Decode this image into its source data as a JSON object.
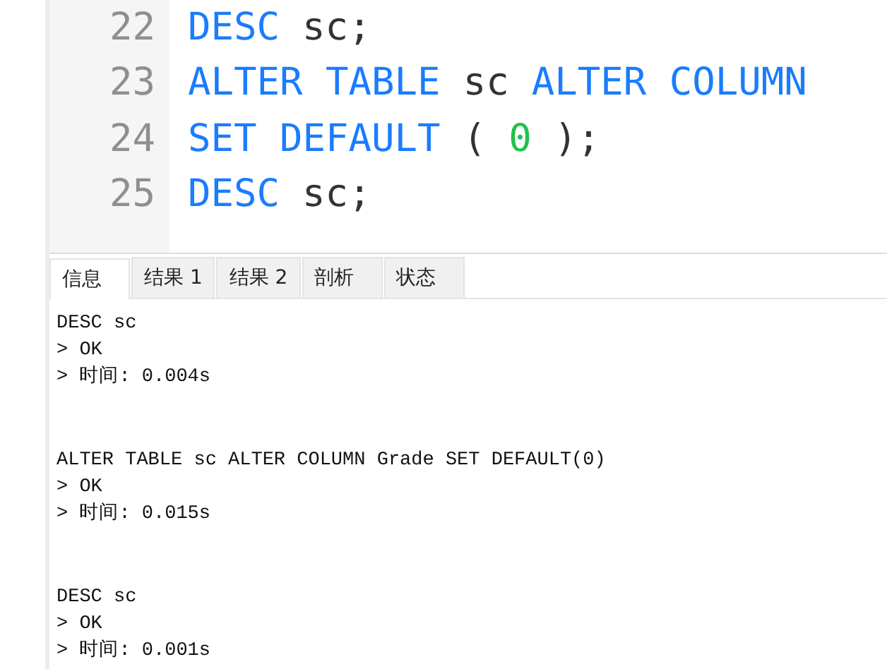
{
  "editor": {
    "lines": [
      {
        "number": "22",
        "tokens": [
          {
            "kind": "keyword",
            "text": "DESC"
          },
          {
            "kind": "plain",
            "text": "sc;"
          }
        ]
      },
      {
        "number": "23",
        "tokens": [
          {
            "kind": "keyword",
            "text": "ALTER TABLE"
          },
          {
            "kind": "plain",
            "text": "sc"
          },
          {
            "kind": "keyword",
            "text": "ALTER COLUMN"
          }
        ]
      },
      {
        "number": "24",
        "tokens": [
          {
            "kind": "keyword",
            "text": "SET DEFAULT"
          },
          {
            "kind": "plain",
            "text": "("
          },
          {
            "kind": "number",
            "text": "0"
          },
          {
            "kind": "plain",
            "text": ");"
          }
        ]
      },
      {
        "number": "25",
        "tokens": [
          {
            "kind": "keyword",
            "text": "DESC"
          },
          {
            "kind": "plain",
            "text": "sc;"
          }
        ]
      }
    ]
  },
  "tabs": [
    {
      "label": "信息",
      "selected": true
    },
    {
      "label": "结果 1",
      "selected": false
    },
    {
      "label": "结果 2",
      "selected": false
    },
    {
      "label": "剖析",
      "selected": false
    },
    {
      "label": "状态",
      "selected": false
    }
  ],
  "output": [
    {
      "lines": [
        "DESC sc",
        "> OK",
        "> 时间: 0.004s"
      ]
    },
    {
      "lines": [
        "ALTER TABLE sc ALTER COLUMN Grade SET DEFAULT(0)",
        "> OK",
        "> 时间: 0.015s"
      ]
    },
    {
      "lines": [
        "DESC sc",
        "> OK",
        "> 时间: 0.001s"
      ]
    }
  ]
}
